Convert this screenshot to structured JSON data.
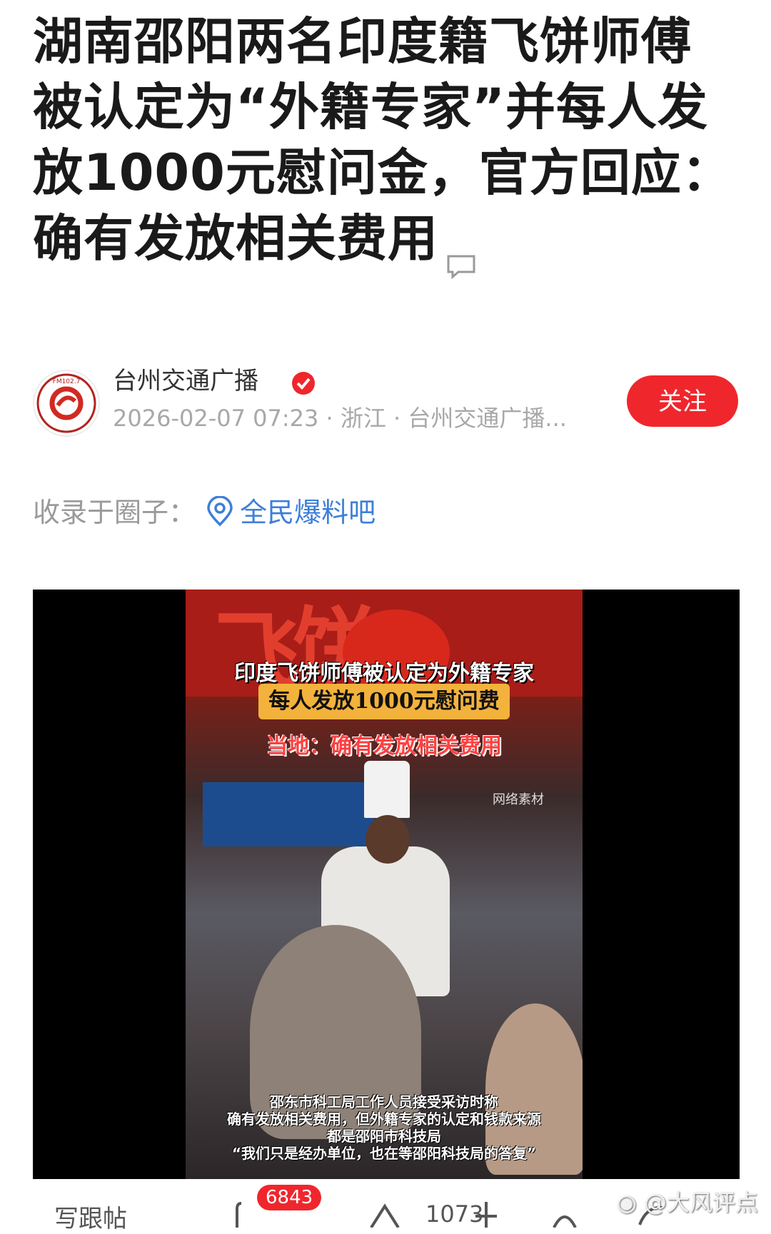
{
  "article": {
    "title": "湖南邵阳两名印度籍飞饼师傅被认定为“外籍专家”并每人发放1000元慰问金，官方回应：确有发放相关费用"
  },
  "author": {
    "name": "台州交通广播",
    "meta": "2026-02-07 07:23 · 浙江 · 台州交通广播...",
    "avatar_text": "FM102.7",
    "follow_label": "关注"
  },
  "circle": {
    "label": "收录于圈子：",
    "name": "全民爆料吧"
  },
  "video": {
    "caption_1": "印度飞饼师傅被认定为外籍专家",
    "caption_2": "每人发放1000元慰问费",
    "caption_3": "当地：确有发放相关费用",
    "watermark": "网络素材",
    "sign_char_1": "飞",
    "sign_char_2": "饼",
    "bottom_lines": [
      "邵东市科工局工作人员接受采访时称",
      "确有发放相关费用，但外籍专家的认定和钱款来源",
      "都是邵阳市科技局",
      "“我们只是经办单位，也在等邵阳科技局的答复”"
    ]
  },
  "toolbar": {
    "left_label": "写跟帖",
    "comment_count": "6843",
    "like_count": "1073"
  },
  "watermark": "@大风评点",
  "colors": {
    "accent": "#f0262d",
    "link": "#3d7fd9",
    "meta": "#a8a8a8"
  }
}
